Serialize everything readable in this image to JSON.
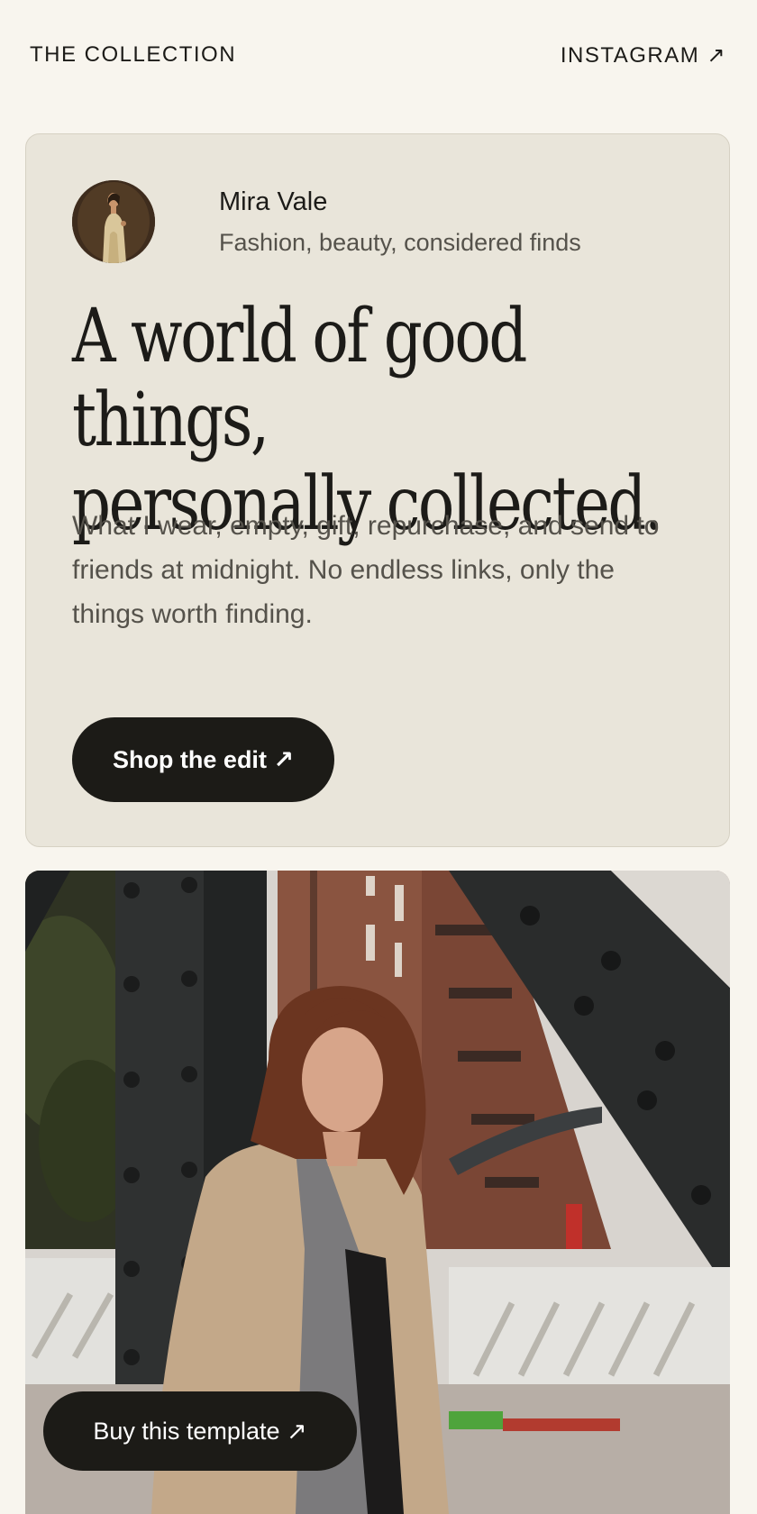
{
  "nav": {
    "brand": "THE COLLECTION",
    "instagram_label": "INSTAGRAM ↗"
  },
  "profile": {
    "name": "Mira Vale",
    "tagline": "Fashion, beauty, considered finds"
  },
  "hero": {
    "headline_line1": "A world of good things,",
    "headline_line2": "personally collected.",
    "intro": "What I wear, empty, gift, repurchase, and send to friends at midnight. No endless links, only the things worth finding.",
    "cta_label": "Shop the edit ↗"
  },
  "photo": {
    "buy_label": "Buy this template ↗"
  },
  "colors": {
    "page_bg": "#f8f5ee",
    "card_bg": "#e9e5da",
    "ink": "#1c1b18",
    "muted": "#55524b",
    "button_bg": "#1c1b17"
  },
  "icons": {
    "external_arrow": "north-east-arrow"
  }
}
